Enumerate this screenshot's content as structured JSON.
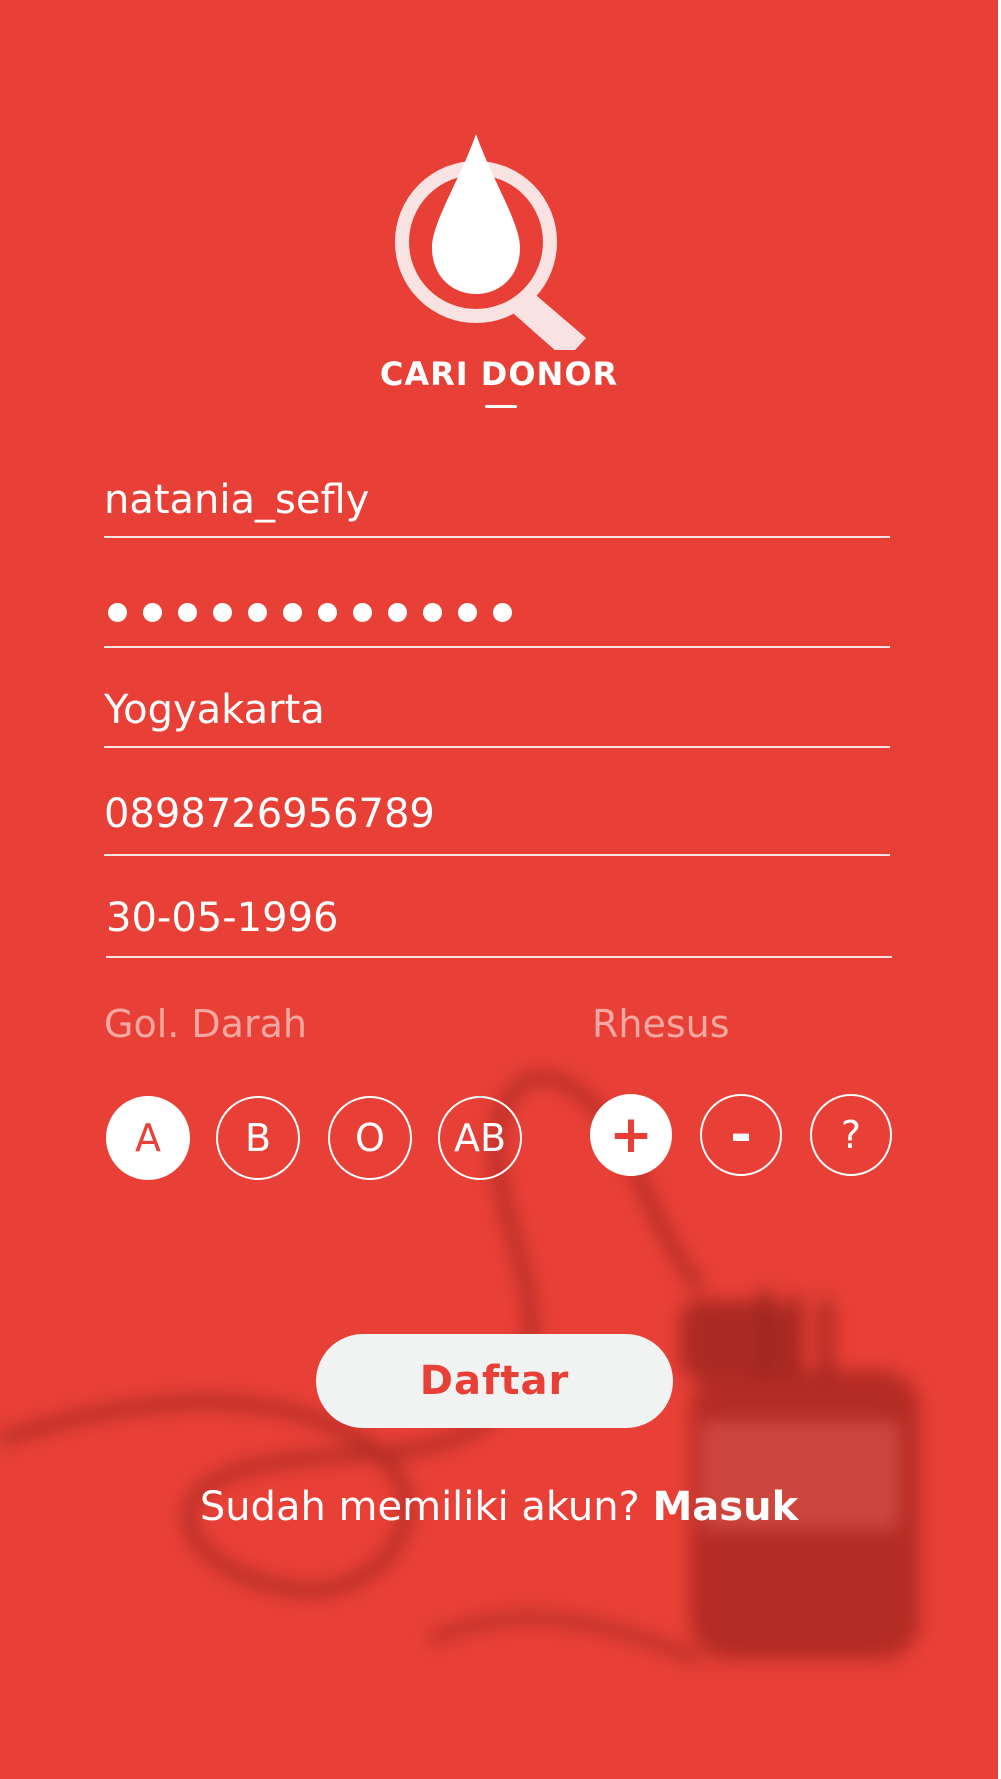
{
  "app": {
    "name": "CARI DONOR",
    "accent": "#e84036"
  },
  "form": {
    "username": "natania_sefly",
    "password_mask_count": 12,
    "city": "Yogyakarta",
    "phone": "0898726956789",
    "birthdate": "30-05-1996"
  },
  "blood_type": {
    "label": "Gol. Darah",
    "options": [
      "A",
      "B",
      "O",
      "AB"
    ],
    "selected": "A"
  },
  "rhesus": {
    "label": "Rhesus",
    "options": [
      "+",
      "-",
      "?"
    ],
    "selected": "+"
  },
  "submit": {
    "label": "Daftar"
  },
  "footer": {
    "prompt": "Sudah memiliki akun?",
    "link": "Masuk"
  }
}
